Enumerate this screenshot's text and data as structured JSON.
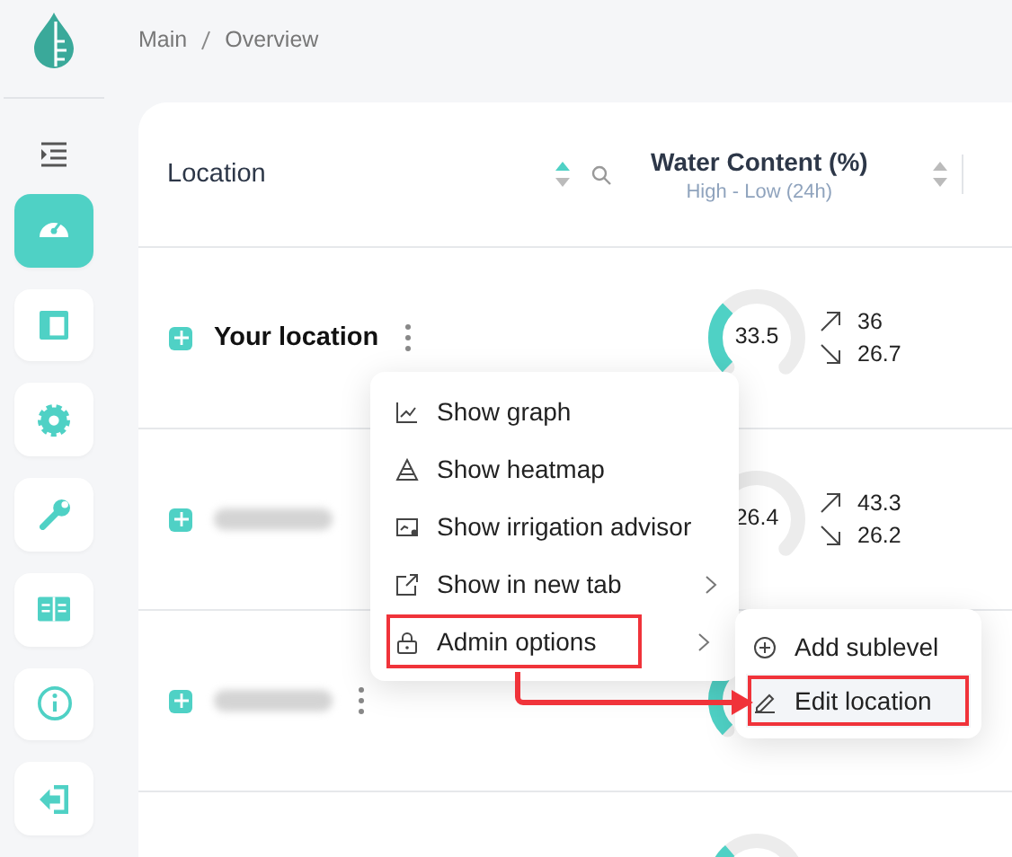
{
  "sidebar": {
    "items": [
      {
        "kind": "collapse",
        "selected": false
      },
      {
        "kind": "dashboard",
        "selected": true
      },
      {
        "kind": "layout",
        "selected": false
      },
      {
        "kind": "settings",
        "selected": false
      },
      {
        "kind": "wrench",
        "selected": false
      },
      {
        "kind": "book",
        "selected": false
      },
      {
        "kind": "info",
        "selected": false
      },
      {
        "kind": "logout",
        "selected": false
      }
    ]
  },
  "breadcrumb": [
    "Main",
    "Overview"
  ],
  "table": {
    "columns": [
      {
        "title": "Location",
        "sorted": true,
        "searchable": true
      },
      {
        "title": "Water Content (%)",
        "subtitle": "High - Low (24h)",
        "sorted": false,
        "searchable": false
      }
    ],
    "rows": [
      {
        "name": "Your location",
        "redacted": false,
        "menu_button": true,
        "value": "33.5",
        "high": "36",
        "low": "26.7"
      },
      {
        "redacted": true,
        "menu_button": false,
        "value": "26.4",
        "high": "43.3",
        "low": "26.2"
      },
      {
        "redacted": true,
        "menu_button": true
      },
      {}
    ]
  },
  "context_menu": {
    "items": [
      {
        "label": "Show graph",
        "submenu": false,
        "annotated": false
      },
      {
        "label": "Show heatmap",
        "submenu": false,
        "annotated": false
      },
      {
        "label": "Show irrigation advisor",
        "submenu": false,
        "annotated": false
      },
      {
        "label": "Show in new tab",
        "submenu": true,
        "annotated": false
      },
      {
        "label": "Admin options",
        "submenu": true,
        "annotated": true
      }
    ]
  },
  "submenu": {
    "items": [
      {
        "label": "Add sublevel",
        "selected": false,
        "annotated": false
      },
      {
        "label": "Edit location",
        "selected": true,
        "annotated": true
      }
    ]
  }
}
